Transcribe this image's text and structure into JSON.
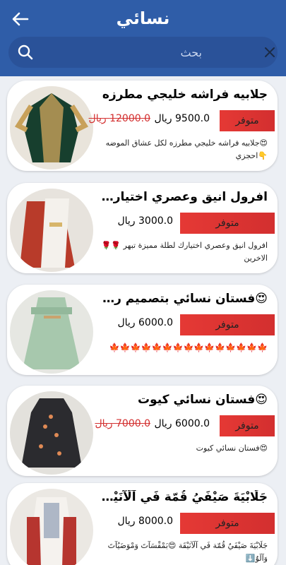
{
  "header": {
    "title": "نسائي",
    "back_icon": "arrow-left-icon",
    "background_color": "#2f5da8"
  },
  "search": {
    "placeholder": "بحث",
    "value": "",
    "search_icon": "search-icon",
    "close_icon": "close-icon"
  },
  "products": [
    {
      "title": "جلابيه فراشه خليجي مطرزه",
      "availability": "متوفر",
      "price": "9500.0 ريال",
      "old_price": "12000.0 ريال",
      "description": "😍جلابيه فراشه خليجي مطرزه لكل عشاق الموضه 👇احجزي"
    },
    {
      "title": "افرول انيق وعصري اختيارك لطلة ...",
      "availability": "متوفر",
      "price": "3000.0 ريال",
      "old_price": "",
      "description": "افرول انيق وعصري اختيارك لطلة مميزة تبهر 🌹🌹 الاخرين"
    },
    {
      "title": "😍فستان نسائي بتصميم رهيبيب",
      "availability": "متوفر",
      "price": "6000.0 ريال",
      "old_price": "",
      "description": "🍁🍁🍁🍁🍁🍁🍁🍁🍁🍁🍁🍁🍁🍁🍁"
    },
    {
      "title": "😍فستان نسائي كيوت",
      "availability": "متوفر",
      "price": "6000.0 ريال",
      "old_price": "7000.0 ريال",
      "description": "😍فستان نسائي كيوت"
    },
    {
      "title": "جَلَابْيَةَ صَيْفَيُ قُمّة فَي آلَآنَيْقَة",
      "availability": "متوفر",
      "price": "8000.0 ريال",
      "old_price": "",
      "description": "جَلَابْيَةَ صَيْفَيُ قُمّة فَي آلَآنَيْقَة 😍بَمْقْسَآتَ وَمْوَضَيُآتَ وَآلَوٌ⬇️"
    }
  ]
}
